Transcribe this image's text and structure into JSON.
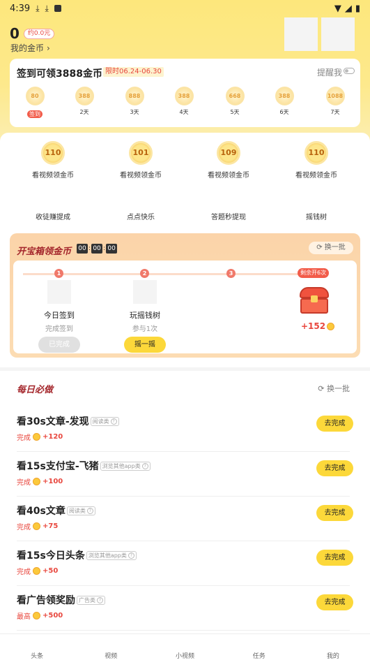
{
  "status_bar": {
    "time": "4:39"
  },
  "header": {
    "coin_count": "0",
    "yuan_badge": "约0.0元",
    "my_coins_label": "我的金币"
  },
  "sign_in": {
    "title": "签到可领3888金币",
    "limit_tag": "限时06.24-06.30",
    "remind_label": "提醒我",
    "days": [
      {
        "coin": "80",
        "label": "签到",
        "today": true
      },
      {
        "coin": "388",
        "label": "2天"
      },
      {
        "coin": "888",
        "label": "3天"
      },
      {
        "coin": "388",
        "label": "4天"
      },
      {
        "coin": "668",
        "label": "5天"
      },
      {
        "coin": "388",
        "label": "6天"
      },
      {
        "coin": "1088",
        "label": "7天"
      }
    ]
  },
  "video_tasks": [
    {
      "coin": "110",
      "label": "看视频领金币"
    },
    {
      "coin": "101",
      "label": "看视频领金币"
    },
    {
      "coin": "109",
      "label": "看视频领金币"
    },
    {
      "coin": "110",
      "label": "看视频领金币"
    }
  ],
  "quick_links": [
    "收徒赚提成",
    "点点快乐",
    "答题秒提现",
    "摇钱树"
  ],
  "treasure": {
    "title": "开宝箱领金币",
    "timer": [
      "00",
      "00",
      "00"
    ],
    "swap_label": "换一批",
    "steps": [
      {
        "num": "1",
        "title": "今日签到",
        "sub": "完成签到",
        "button": "已完成"
      },
      {
        "num": "2",
        "title": "玩摇钱树",
        "sub": "参与1次",
        "button": "摇一摇"
      },
      {
        "num": "3"
      }
    ],
    "remain_label": "剩余开6次",
    "reward": "+152"
  },
  "daily": {
    "title": "每日必做",
    "swap_label": "换一批",
    "tasks": [
      {
        "title": "看30s文章-发现",
        "tag": "阅读类",
        "reward_prefix": "完成",
        "reward": "+120",
        "button": "去完成"
      },
      {
        "title": "看15s支付宝-飞猪",
        "tag": "浏览其他app类",
        "reward_prefix": "完成",
        "reward": "+100",
        "button": "去完成"
      },
      {
        "title": "看40s文章",
        "tag": "阅读类",
        "reward_prefix": "完成",
        "reward": "+75",
        "button": "去完成"
      },
      {
        "title": "看15s今日头条",
        "tag": "浏览其他app类",
        "reward_prefix": "完成",
        "reward": "+50",
        "button": "去完成"
      },
      {
        "title": "看广告领奖励",
        "tag": "广告类",
        "reward_prefix": "最高",
        "reward": "+500",
        "button": "去完成"
      }
    ]
  },
  "nav": [
    "头条",
    "视频",
    "小视频",
    "任务",
    "我的"
  ]
}
